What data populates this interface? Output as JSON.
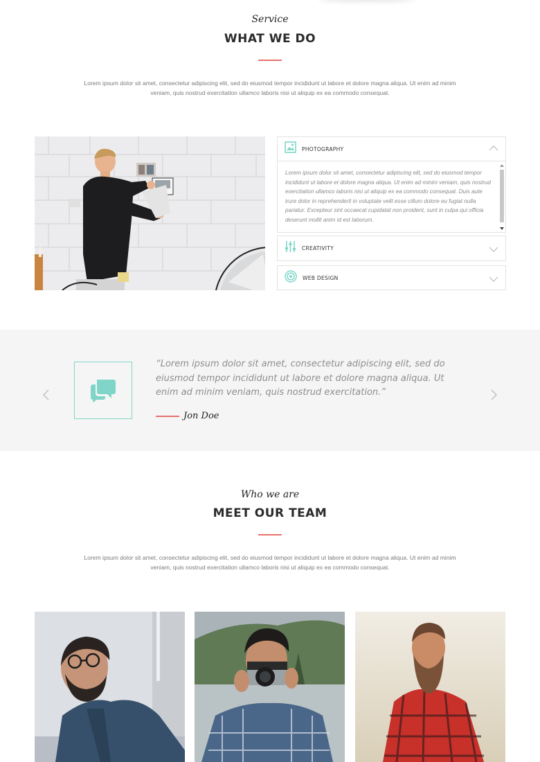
{
  "services": {
    "script_title": "Service",
    "title": "WHAT WE DO",
    "lead": "Lorem ipsum dolor sit amet, consectetur adipiscing elit, sed do eiusmod tempor incididunt ut labore et dolore magna aliqua. Ut enim ad minim veniam, quis nostrud exercitation ullamco laboris nisi ut aliquip ex ea commodo consequat.",
    "accordion": [
      {
        "title": "PHOTOGRAPHY",
        "icon": "image-icon",
        "expanded": true,
        "body": "Lorem ipsum dolor sit amet, consectetur adipiscing elit, sed do eiusmod tempor incididunt ut labore et dolore magna aliqua. Ut enim ad minim veniam, quis nostrud exercitation ullamco laboris nisi ut aliquip ex ea commodo consequat. Duis aute irure dolor in reprehenderit in voluptate velit esse cillum dolore eu fugiat nulla pariatur. Excepteur sint occaecat cupidatat non proident, sunt in culpa qui officia deserunt mollit anim id est laborum."
      },
      {
        "title": "CREATIVITY",
        "icon": "sliders-icon",
        "expanded": false
      },
      {
        "title": "WEB DESIGN",
        "icon": "target-icon",
        "expanded": false
      }
    ]
  },
  "testimonial": {
    "quote": "“Lorem ipsum dolor sit amet, consectetur adipiscing elit, sed do eiusmod tempor incididunt ut labore et dolore magna aliqua. Ut enim ad minim veniam, quis nostrud exercitation.”",
    "author": "Jon Doe",
    "icon": "chat-bubbles-icon"
  },
  "team": {
    "script_title": "Who we are",
    "title": "MEET OUR TEAM",
    "lead": "Lorem ipsum dolor sit amet, consectetur adipiscing elit, sed do eiusmod tempor incididunt ut labore et dolore magna aliqua. Ut enim ad minim veniam, quis nostrud exercitation ullamco laboris nisi ut aliquip ex ea commodo consequat."
  },
  "colors": {
    "accent_red": "#e8716e",
    "accent_teal": "#7fd6c8",
    "band_bg": "#f5f5f5"
  }
}
